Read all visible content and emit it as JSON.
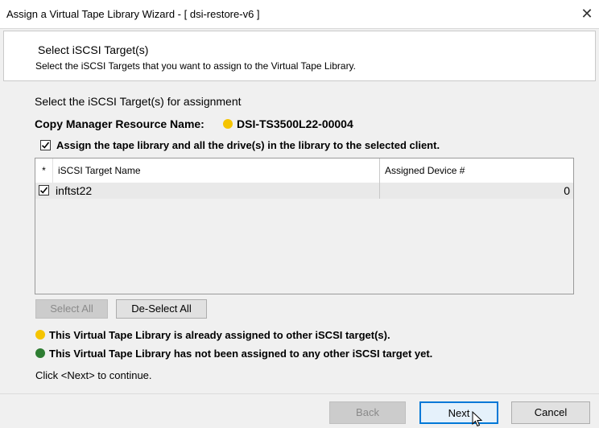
{
  "window": {
    "title": "Assign a Virtual Tape Library Wizard - [ dsi-restore-v6 ]",
    "close_glyph": "✕"
  },
  "header": {
    "title": "Select iSCSI Target(s)",
    "subtitle": "Select the iSCSI Targets that you want to assign to the Virtual Tape Library."
  },
  "content": {
    "instruction": "Select the iSCSI Target(s) for assignment",
    "resource_label": "Copy Manager Resource Name:",
    "resource_name": "DSI-TS3500L22-00004",
    "assign_all_label": "Assign the tape library and all the drive(s) in the library to the selected client.",
    "assign_all_checked": true
  },
  "table": {
    "columns": [
      "*",
      "iSCSI Target Name",
      "Assigned Device #"
    ],
    "rows": [
      {
        "checked": true,
        "name": "inftst22",
        "assigned": "0"
      }
    ]
  },
  "buttons": {
    "select_all": "Select All",
    "deselect_all": "De-Select All",
    "back": "Back",
    "next": "Next",
    "cancel": "Cancel"
  },
  "legend": {
    "assigned": "This Virtual Tape Library is already assigned to other iSCSI target(s).",
    "not_assigned": "This Virtual Tape Library has not been assigned to any other iSCSI target yet.",
    "assigned_color": "#f5c400",
    "not_assigned_color": "#2e7d32"
  },
  "hint": "Click <Next> to continue."
}
